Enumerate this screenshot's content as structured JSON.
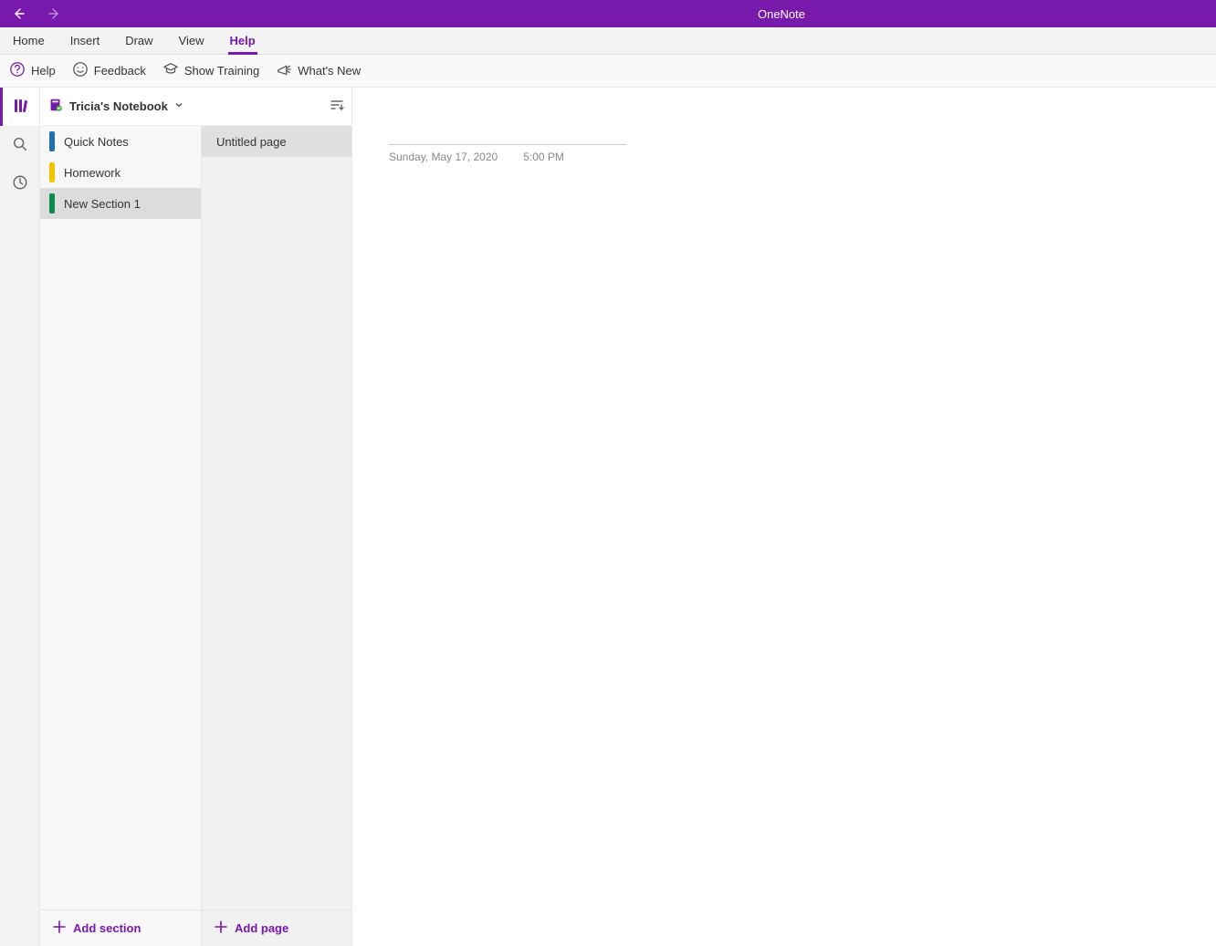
{
  "titleBar": {
    "appName": "OneNote"
  },
  "menuTabs": [
    {
      "label": "Home",
      "active": false
    },
    {
      "label": "Insert",
      "active": false
    },
    {
      "label": "Draw",
      "active": false
    },
    {
      "label": "View",
      "active": false
    },
    {
      "label": "Help",
      "active": true
    }
  ],
  "ribbon": {
    "help": "Help",
    "feedback": "Feedback",
    "training": "Show Training",
    "whatsnew": "What's New"
  },
  "notebook": {
    "name": "Tricia's Notebook"
  },
  "sections": [
    {
      "label": "Quick Notes",
      "color": "#1f6fb3",
      "selected": false
    },
    {
      "label": "Homework",
      "color": "#f2c400",
      "selected": false
    },
    {
      "label": "New Section 1",
      "color": "#0f8a4b",
      "selected": true
    }
  ],
  "pages": [
    {
      "label": "Untitled page",
      "selected": true
    }
  ],
  "pageContent": {
    "titlePlaceholder": "",
    "date": "Sunday, May 17, 2020",
    "time": "5:00 PM"
  },
  "footer": {
    "addSection": "Add section",
    "addPage": "Add page"
  }
}
